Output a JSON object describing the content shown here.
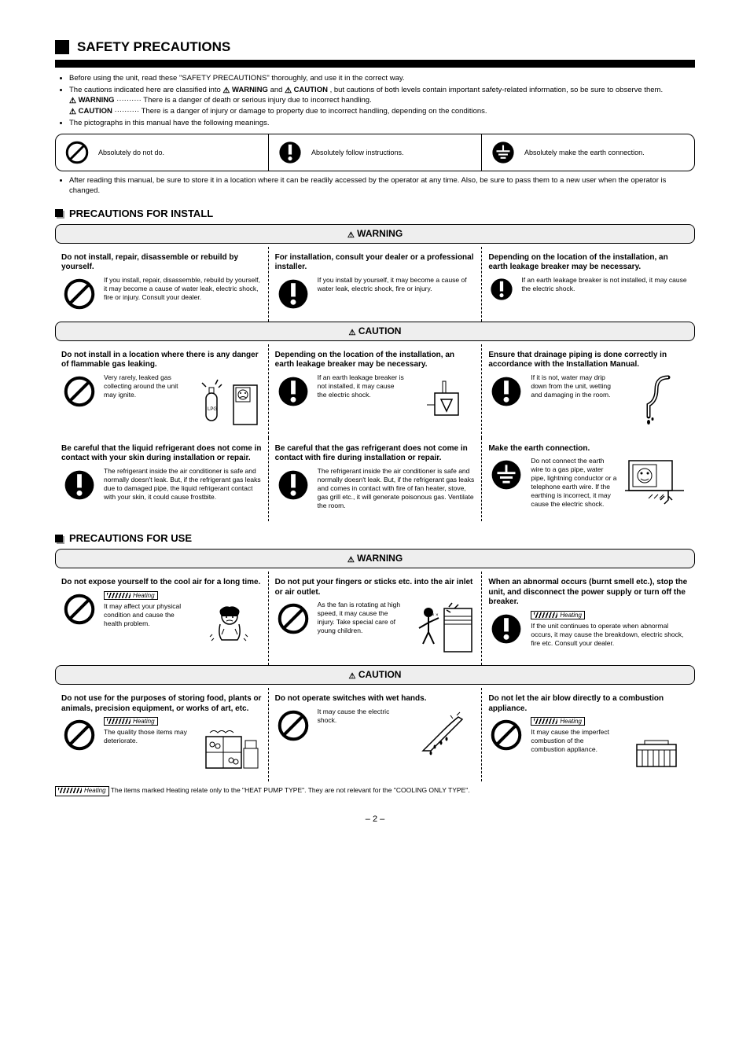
{
  "page_number": "2",
  "section": {
    "title": "SAFETY PRECAUTIONS"
  },
  "intro": {
    "b1": "Before using the unit, read these \"SAFETY PRECAUTIONS\" thoroughly, and use it in the correct way.",
    "b2_a": "The cautions indicated here are classified into ",
    "b2_b": " and ",
    "b2_c": ", but cautions of both levels contain important safety-related information, so be sure to observe them.",
    "warn_label": "WARNING",
    "warn_desc": "There is a danger of death or serious injury due to incorrect handling.",
    "caut_label": "CAUTION",
    "caut_desc": "There is a danger of injury or damage to property due to incorrect handling, depending on the conditions.",
    "b3": "The pictographs in this manual have the following meanings.",
    "b4": "After reading this manual, be sure to store it in a location where it can be readily accessed by the operator at any time. Also, be sure to pass them to a new user when the operator is changed."
  },
  "pictos": {
    "p1": "Absolutely do not do.",
    "p2": "Absolutely follow instructions.",
    "p3": "Absolutely make the earth connection."
  },
  "install": {
    "title": "PRECAUTIONS FOR INSTALL",
    "warn_bar": "WARNING",
    "w1_title": "Do not install, repair, disassemble or rebuild by yourself.",
    "w1_text": "If you install, repair, disassemble, rebuild by yourself, it may become a cause of water leak, electric shock, fire or injury. Consult your dealer.",
    "w2_title": "For installation, consult your dealer or a professional installer.",
    "w2_text": "If you install by yourself, it may become a cause of water leak, electric shock, fire or injury.",
    "w3_title": "Depending on the location of the installation, an earth leakage breaker may be necessary.",
    "w3_text": "If an earth leakage breaker is not installed, it may cause the electric shock.",
    "caut_bar": "CAUTION",
    "c1_title": "Do not install in a location where there is any danger of flammable gas leaking.",
    "c1_text": "Very rarely, leaked gas collecting around the unit may ignite.",
    "c2_title": "Depending on the location of the installation, an earth leakage breaker may be necessary.",
    "c2_text": "If an earth leakage breaker is not installed, it may cause the electric shock.",
    "c3_title": "Ensure that drainage piping is done correctly in accordance with the Installation Manual.",
    "c3_text": "If it is not, water may drip down from the unit, wetting and damaging in the room.",
    "c4_title": "Be careful that the liquid refrigerant does not come in contact with your skin during installation or repair.",
    "c4_text": "The refrigerant inside the air conditioner is safe and normally doesn't leak. But, if the refrigerant gas leaks due to damaged pipe, the liquid refrigerant contact with your skin, it could cause frostbite.",
    "c5_title": "Be careful that the gas refrigerant does not come in contact with fire during installation or repair.",
    "c5_text": "The refrigerant inside the air conditioner is safe and normally doesn't leak. But, if the refrigerant gas leaks and comes in contact with fire of fan heater, stove, gas grill etc., it will generate poisonous gas. Ventilate the room.",
    "c6_title": "Make the earth connection.",
    "c6_text": "Do not connect the earth wire to a gas pipe, water pipe, lightning conductor or a telephone earth wire. If the earthing is incorrect, it may cause the electric shock."
  },
  "use": {
    "title": "PRECAUTIONS FOR USE",
    "warn_bar": "WARNING",
    "w1_title": "Do not expose yourself to the cool air for a long time.",
    "w1_text": "It may affect your physical condition and cause the health problem.",
    "w2_title": "Do not put your fingers or sticks etc. into the air inlet or air outlet.",
    "w2_text": "As the fan is rotating at high speed, it may cause the injury. Take special care of young children.",
    "w3_title": "When an abnormal occurs (burnt smell etc.), stop the unit, and disconnect the power supply or turn off the breaker.",
    "w3_text": "If the unit continues to operate when abnormal occurs, it may cause the breakdown, electric shock, fire etc. Consult your dealer.",
    "caut_bar": "CAUTION",
    "c1_title": "Do not use for the purposes of storing food, plants or animals, precision equipment, or works of art, etc.",
    "c1_text": "The quality those items may deteriorate.",
    "c2_title": "Do not operate switches with wet hands.",
    "c2_text": "It may cause the electric shock.",
    "c3_title": "Do not let the air blow directly to a combustion appliance.",
    "c3_text": "It may cause the imperfect combustion of the combustion appliance."
  },
  "heating_label": "Heating",
  "heating_note": "The items marked Heating relate only to the \"HEAT PUMP TYPE\". They are not relevant for the \"COOLING ONLY TYPE\"."
}
